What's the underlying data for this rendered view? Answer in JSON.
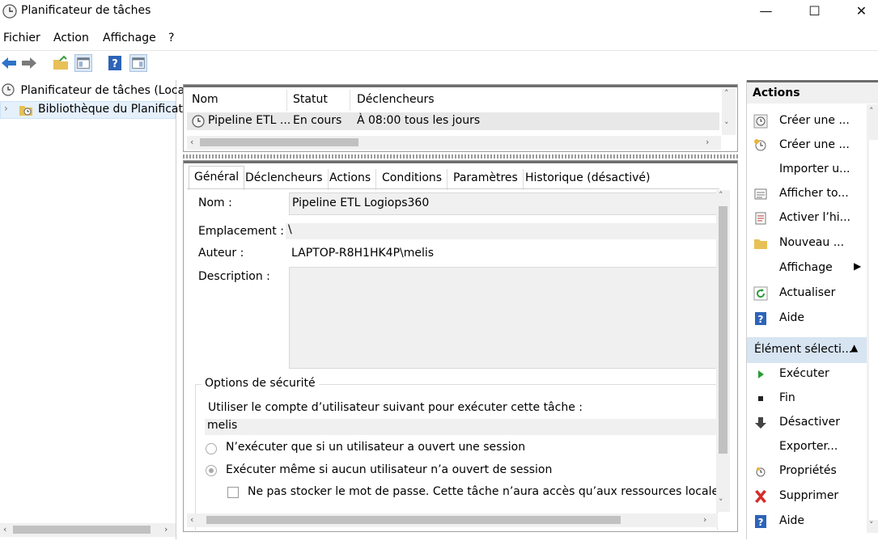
{
  "window": {
    "title": "Planificateur de tâches",
    "minimize": "—",
    "maximize": "☐",
    "close": "✕"
  },
  "menu": [
    "Fichier",
    "Action",
    "Affichage",
    "?"
  ],
  "tree": {
    "root": "Planificateur de tâches (Local)",
    "child": "Bibliothèque du Planificat"
  },
  "task_list": {
    "columns": [
      "Nom",
      "Statut",
      "Déclencheurs"
    ],
    "rows": [
      {
        "name": "Pipeline ETL ...",
        "status": "En cours",
        "trigger": "À 08:00 tous les jours"
      }
    ]
  },
  "tabs": [
    "Général",
    "Déclencheurs",
    "Actions",
    "Conditions",
    "Paramètres",
    "Historique (désactivé)"
  ],
  "general": {
    "name_label": "Nom :",
    "name_value": "Pipeline ETL Logiops360",
    "location_label": "Emplacement :",
    "location_value": "\\",
    "author_label": "Auteur :",
    "author_value": "LAPTOP-R8H1HK4P\\melis",
    "description_label": "Description :",
    "description_value": "",
    "security_legend": "Options de sécurité",
    "security_account_text": "Utiliser le compte d’utilisateur suivant pour exécuter cette tâche :",
    "account_value": "melis",
    "radio_logged_on": "N’exécuter que si un utilisateur a ouvert une session",
    "radio_whether": "Exécuter même si aucun utilisateur n’a ouvert de session",
    "chk_no_store": "Ne pas stocker le mot de passe. Cette tâche n’aura accès qu’aux ressources locales"
  },
  "actions": {
    "header": "Actions",
    "items": [
      "Créer une ...",
      "Créer une ...",
      "Importer u...",
      "Afficher to...",
      "Activer l’hi...",
      "Nouveau ...",
      "Affichage",
      "Actualiser",
      "Aide"
    ],
    "selected_header": "Élément sélecti...",
    "selected_items": [
      "Exécuter",
      "Fin",
      "Désactiver",
      "Exporter...",
      "Propriétés",
      "Supprimer",
      "Aide"
    ]
  }
}
